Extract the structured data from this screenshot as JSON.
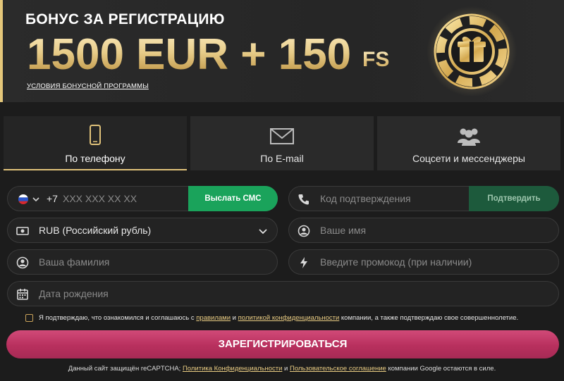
{
  "banner": {
    "subtitle": "БОНУС ЗА РЕГИСТРАЦИЮ",
    "amount": "1500 EUR + 150",
    "fs": "FS",
    "terms_link": "УСЛОВИЯ БОНУСНОЙ ПРОГРАММЫ",
    "accent_color": "#e4c77a"
  },
  "tabs": [
    {
      "label": "По телефону",
      "icon": "phone-icon",
      "active": true
    },
    {
      "label": "По E-mail",
      "icon": "envelope-icon",
      "active": false
    },
    {
      "label": "Соцсети и мессенджеры",
      "icon": "users-icon",
      "active": false
    }
  ],
  "form": {
    "phone": {
      "country_icon": "russia-flag-icon",
      "prefix": "+7",
      "placeholder": "XXX XXX XX XX",
      "button": "Выслать СМС"
    },
    "code": {
      "placeholder": "Код подтверждения",
      "button": "Подтвердить"
    },
    "currency": {
      "value": "RUB (Российский рубль)"
    },
    "name": {
      "placeholder": "Ваше имя"
    },
    "surname": {
      "placeholder": "Ваша фамилия"
    },
    "promo": {
      "placeholder": "Введите промокод (при наличии)"
    },
    "birthdate": {
      "placeholder": "Дата рождения"
    }
  },
  "consent": {
    "part1": "Я подтверждаю, что ознакомился и соглашаюсь с ",
    "link1": "правилами",
    "part2": " и ",
    "link2": "политикой конфиденциальности",
    "part3": " компании, а также подтверждаю свое совершеннолетие."
  },
  "register_button": "ЗАРЕГИСТРИРОВАТЬСЯ",
  "captcha": {
    "part1": "Данный сайт защищён reCAPTCHA; ",
    "link1": "Политика Конфиденциальности",
    "part2": " и ",
    "link2": "Пользовательское соглашение",
    "part3": " компании Google остаются в силе."
  },
  "colors": {
    "green": "#1aa35b",
    "green_dark": "#1d5a3c",
    "pink": "#c33a68",
    "gold": "#e0c27a"
  }
}
